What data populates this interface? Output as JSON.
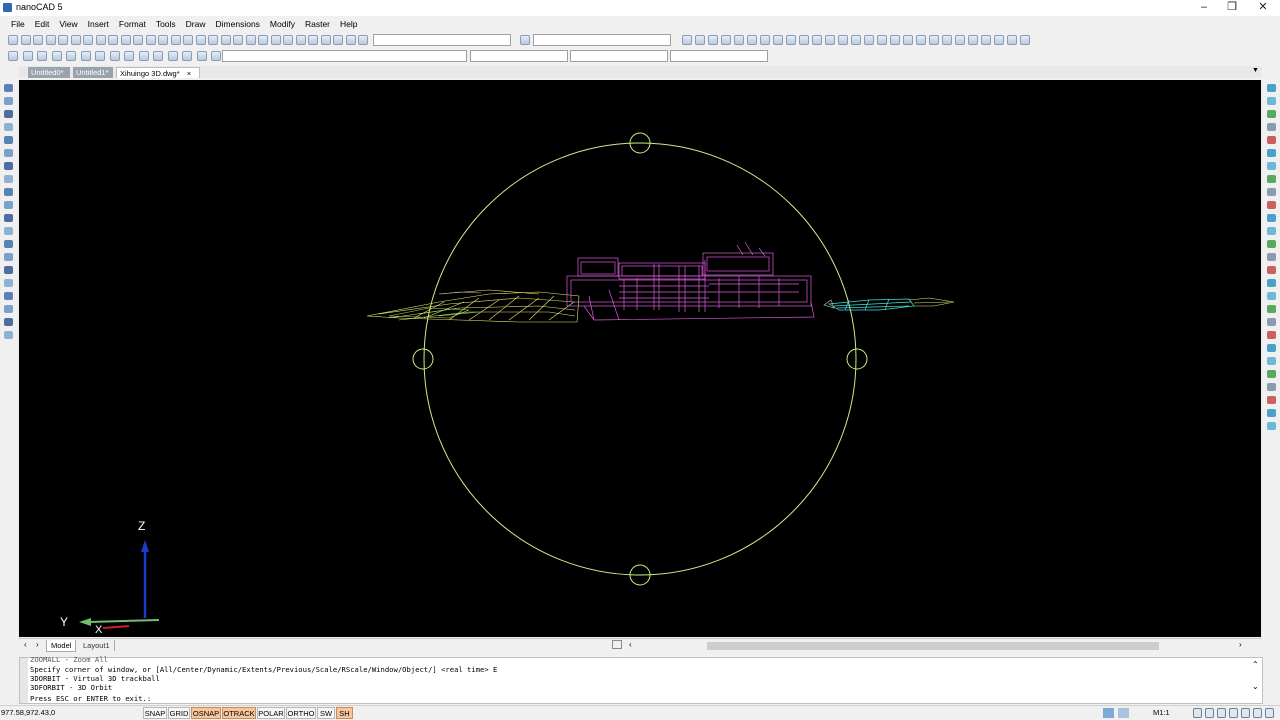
{
  "window": {
    "title": "nanoCAD 5"
  },
  "menu": [
    "File",
    "Edit",
    "View",
    "Insert",
    "Format",
    "Tools",
    "Draw",
    "Dimensions",
    "Modify",
    "Raster",
    "Help"
  ],
  "tabs": [
    {
      "label": "Untitled0*"
    },
    {
      "label": "Untitled1*"
    },
    {
      "label": "Xihuingo 3D.dwg*",
      "close": "×"
    }
  ],
  "model_tabs": [
    {
      "label": "Model"
    },
    {
      "label": "Layout1"
    }
  ],
  "axes": {
    "z": "Z",
    "y": "Y",
    "x": "X"
  },
  "command": {
    "lines": [
      "ZOOMALL - Zoom All",
      "Specify corner of window, or [All/Center/Dynamic/Extents/Previous/Scale/RScale/Window/Object/] <real time> E",
      "3DORBIT - Virtual 3D trackball",
      "3DFORBIT - 3D Orbit",
      "Press ESC or ENTER to exit.:"
    ]
  },
  "status": {
    "coords": "977.58,972.43,0",
    "toggles": [
      {
        "label": "SNAP",
        "on": false
      },
      {
        "label": "GRID",
        "on": false
      },
      {
        "label": "OSNAP",
        "on": true
      },
      {
        "label": "OTRACK",
        "on": true
      },
      {
        "label": "POLAR",
        "on": false
      },
      {
        "label": "ORTHO",
        "on": false
      },
      {
        "label": "SW",
        "on": false
      },
      {
        "label": "SH",
        "on": true
      }
    ],
    "scale": "M1:1"
  },
  "colors": {
    "orbit": "#c8f08a",
    "building": "#e05ae0",
    "terrain_left": "#e8e870",
    "terrain_right": "#44e0e0",
    "z_axis": "#1a3bd0",
    "y_axis": "#70c070",
    "x_axis": "#d02020"
  }
}
